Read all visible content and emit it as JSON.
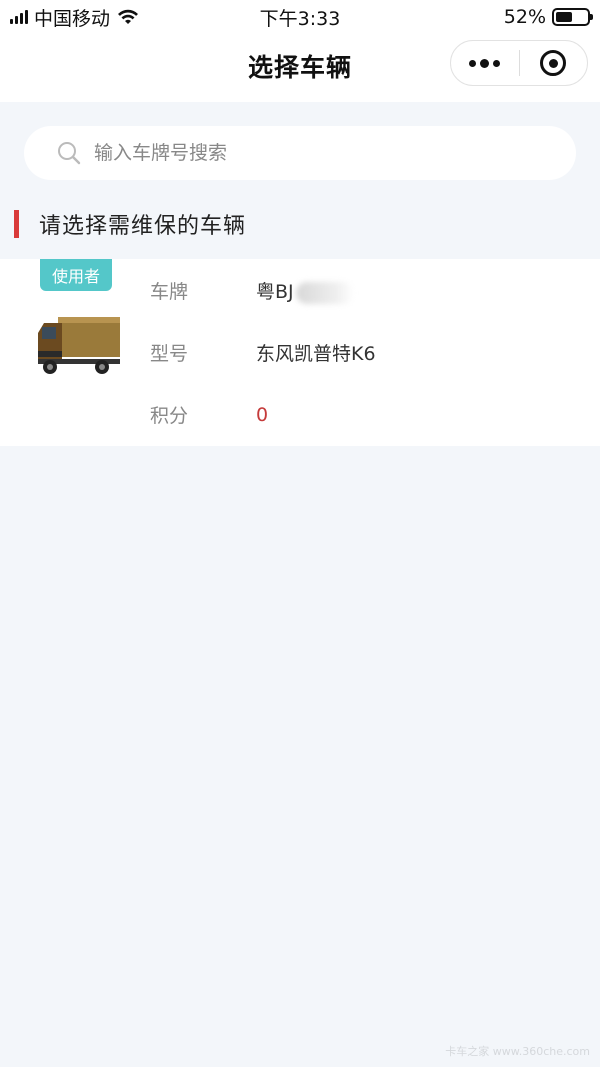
{
  "status_bar": {
    "carrier": "中国移动",
    "time": "下午3:33",
    "battery": "52%"
  },
  "nav": {
    "title": "选择车辆"
  },
  "search": {
    "placeholder": "输入车牌号搜索"
  },
  "section": {
    "title": "请选择需维保的车辆"
  },
  "vehicle": {
    "badge": "使用者",
    "plate_label": "车牌",
    "plate_value": "粤BJ",
    "model_label": "型号",
    "model_value": "东风凯普特K6",
    "points_label": "积分",
    "points_value": "0"
  },
  "watermark": "卡车之家 www.360che.com",
  "colors": {
    "accent_red": "#d93a3a",
    "badge_teal": "#54c7c9",
    "page_bg": "#f3f6fa",
    "points_red": "#c53a3a"
  }
}
